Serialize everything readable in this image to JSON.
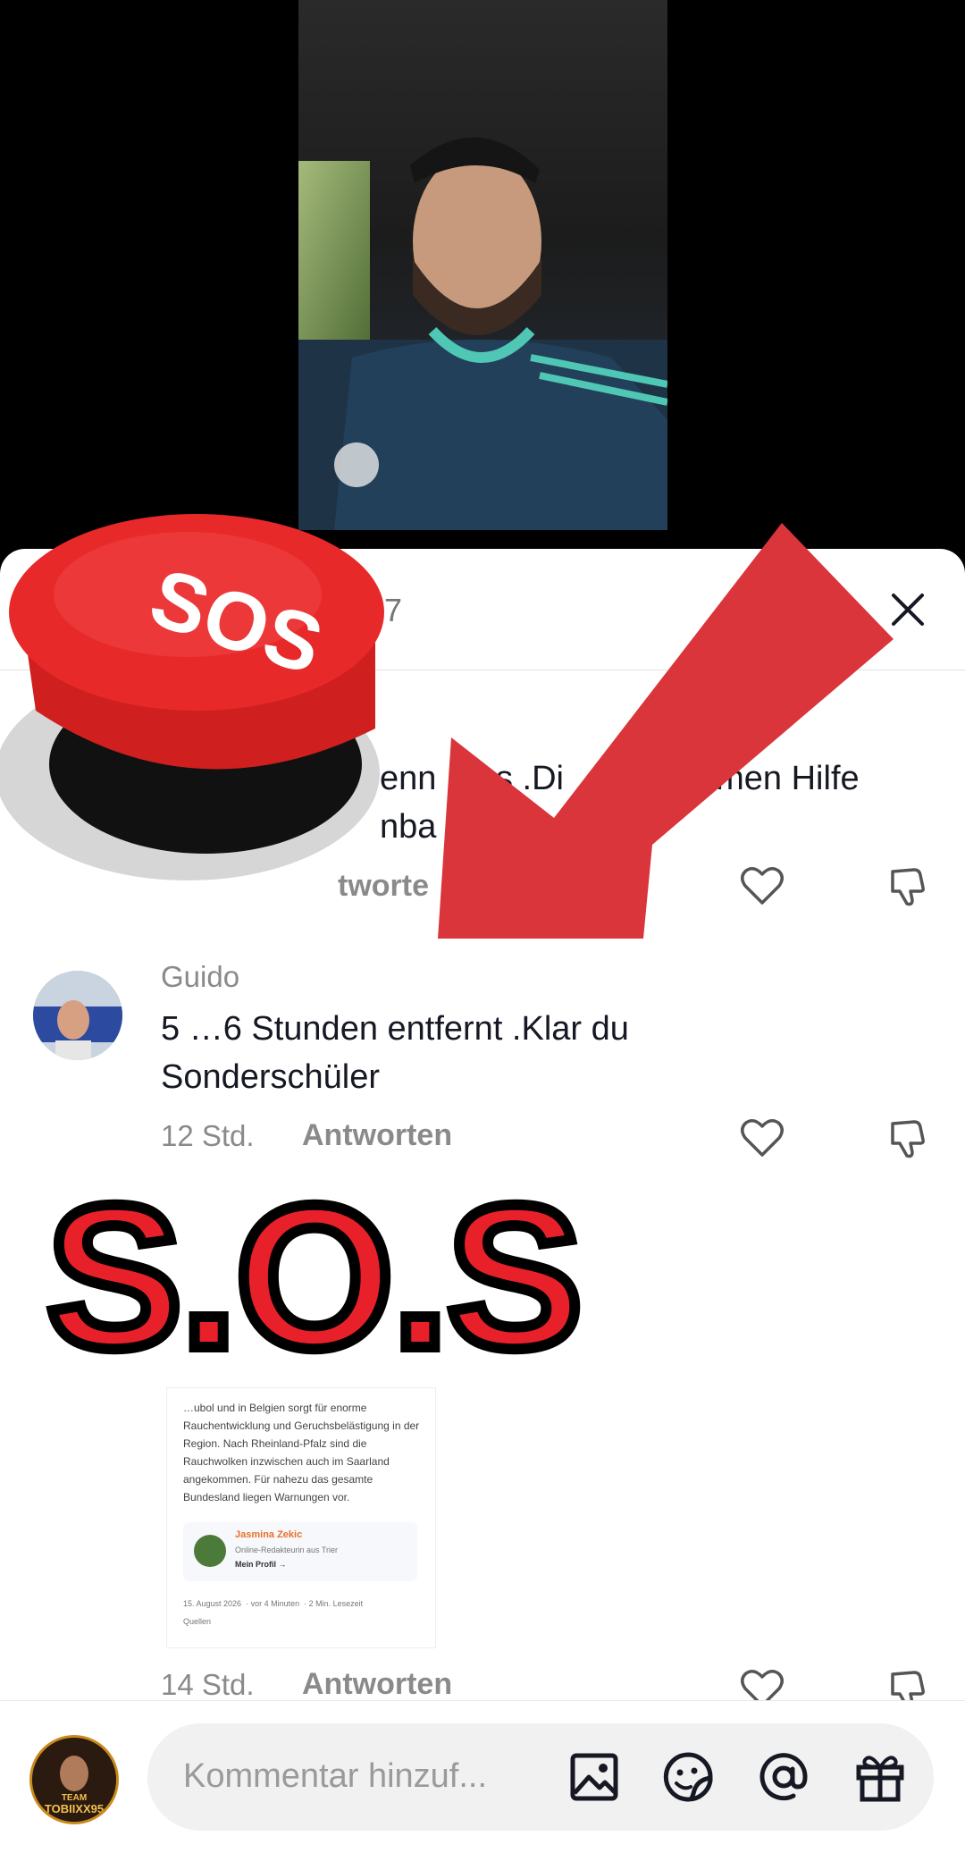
{
  "video": {},
  "comments_sheet": {
    "header": {
      "count_text": "97"
    },
    "comments": [
      {
        "text_fragments": [
          "enn",
          "s .Di",
          "nmen Hilfe",
          "nba"
        ],
        "reply_label": "tworte"
      },
      {
        "username": "Guido",
        "text": "5 …6 Stunden entfernt .Klar du Sonderschüler",
        "time": "12 Std.",
        "reply_label": "Antworten"
      },
      {
        "attachment": {
          "paragraph_top": "…ubol und in Belgien sorgt für enorme",
          "paragraph": "Rauchentwicklung und Geruchsbelästigung in der Region. Nach Rheinland-Pfalz sind die Rauchwolken inzwischen auch im Saarland angekommen. Für nahezu das gesamte Bundesland liegen Warnungen vor.",
          "author_name": "Jasmina Zekic",
          "author_role": "Online-Redakteurin aus Trier",
          "author_link": "Mein Profil →",
          "date": "15. August 2026",
          "ago": "vor 4 Minuten",
          "read_time": "2 Min. Lesezeit",
          "sources": "Quellen"
        },
        "time": "14 Std.",
        "reply_label": "Antworten"
      }
    ]
  },
  "overlay": {
    "button_label": "SOS",
    "big_text": "S.O.S"
  },
  "bottom_bar": {
    "avatar_text_1": "TEAM",
    "avatar_text_2": "TOBIIXX95",
    "input_placeholder": "Kommentar hinzuf..."
  },
  "colors": {
    "overlay_red": "#e8202a",
    "arrow_red": "#d9353b"
  }
}
